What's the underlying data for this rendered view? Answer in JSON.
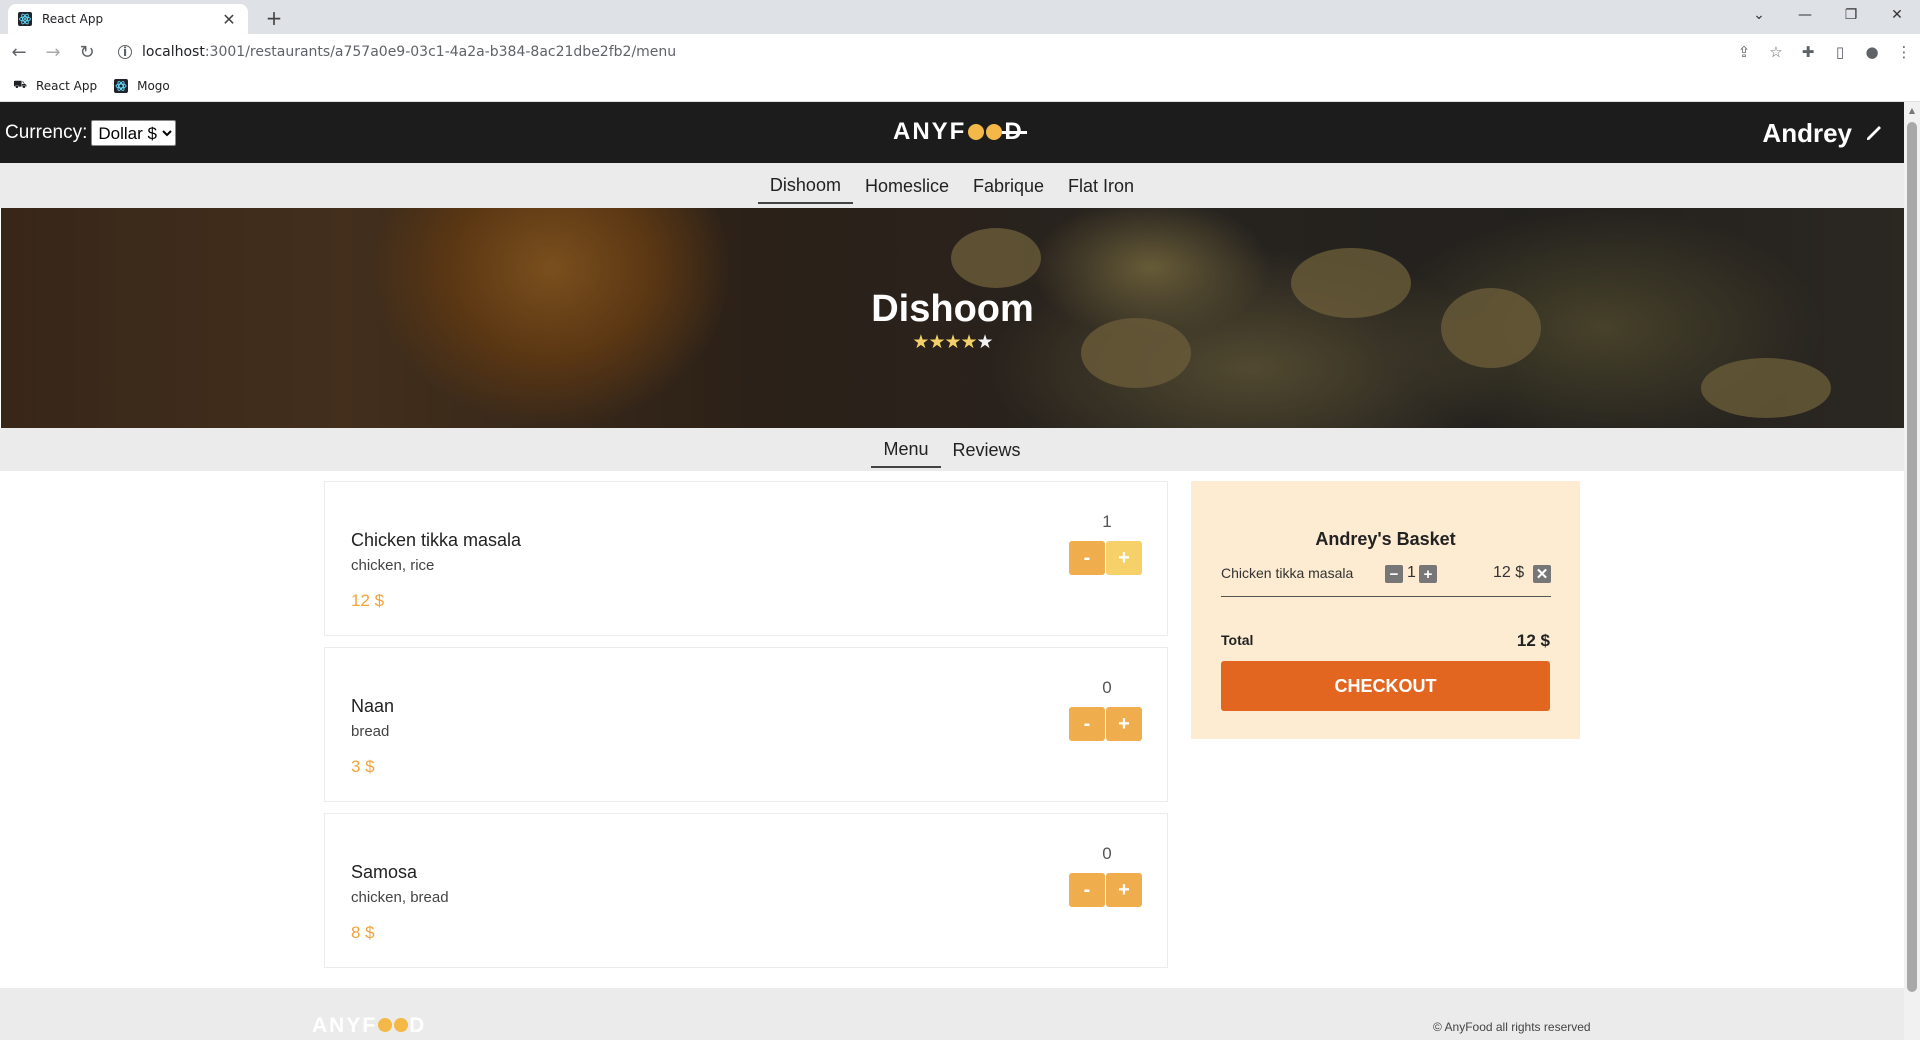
{
  "browser": {
    "tab_title": "React App",
    "url_host": "localhost",
    "url_path": ":3001/restaurants/a757a0e9-03c1-4a2a-b384-8ac21dbe2fb2/menu",
    "bookmarks": [
      {
        "label": "React App",
        "icon": "react-bookmark-icon"
      },
      {
        "label": "Mogo",
        "icon": "mogo-bookmark-icon"
      }
    ]
  },
  "header": {
    "currency_label": "Currency:",
    "currency_selected": "Dollar $",
    "logo_prefix": "ANYF",
    "logo_suffix": "D",
    "user_name": "Andrey"
  },
  "restaurants_nav": [
    {
      "label": "Dishoom",
      "active": true
    },
    {
      "label": "Homeslice",
      "active": false
    },
    {
      "label": "Fabrique",
      "active": false
    },
    {
      "label": "Flat Iron",
      "active": false
    }
  ],
  "hero": {
    "title": "Dishoom",
    "rating": 4,
    "rating_max": 5,
    "stars_full": "★★★★",
    "stars_empty": "★"
  },
  "section_tabs": [
    {
      "label": "Menu",
      "active": true
    },
    {
      "label": "Reviews",
      "active": false
    }
  ],
  "menu": [
    {
      "name": "Chicken tikka masala",
      "ingredients": "chicken, rice",
      "price": "12 $",
      "qty": "1"
    },
    {
      "name": "Naan",
      "ingredients": "bread",
      "price": "3 $",
      "qty": "0"
    },
    {
      "name": "Samosa",
      "ingredients": "chicken, bread",
      "price": "8 $",
      "qty": "0"
    }
  ],
  "buttons": {
    "minus": "-",
    "plus": "+"
  },
  "basket": {
    "title": "Andrey's Basket",
    "item_name": "Chicken tikka masala",
    "item_qty": "1",
    "item_price": "12 $",
    "total_label": "Total",
    "total_value": "12 $",
    "checkout_label": "CHECKOUT"
  },
  "footer": {
    "copyright": "© AnyFood all rights reserved"
  },
  "colors": {
    "header_bg": "#1c1c1c",
    "accent_orange": "#e2661f",
    "button_amber": "#f0ad4e",
    "price_color": "#f0a43c",
    "basket_bg": "#fdebd2"
  }
}
